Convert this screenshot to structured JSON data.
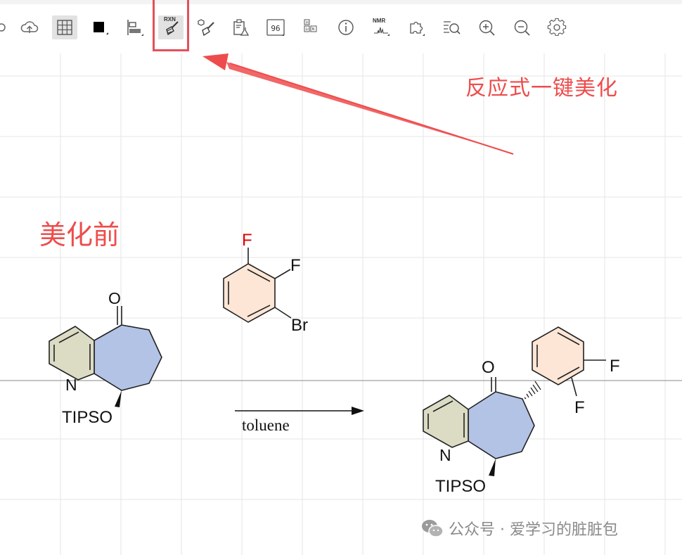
{
  "toolbar": {
    "items": [
      {
        "name": "upload-icon"
      },
      {
        "name": "grid-icon"
      },
      {
        "name": "color-fill-icon"
      },
      {
        "name": "align-icon"
      },
      {
        "name": "reaction-cleanup-icon",
        "label": "RXN"
      },
      {
        "name": "structure-cleanup-icon"
      },
      {
        "name": "clipboard-flask-icon"
      },
      {
        "name": "plate-96-icon",
        "label": "96"
      },
      {
        "name": "periodic-table-icon"
      },
      {
        "name": "info-icon"
      },
      {
        "name": "nmr-icon",
        "label": "NMR"
      },
      {
        "name": "puzzle-icon"
      },
      {
        "name": "search-structure-icon"
      },
      {
        "name": "zoom-in-icon"
      },
      {
        "name": "zoom-out-icon"
      },
      {
        "name": "settings-gear-icon"
      }
    ]
  },
  "annotations": {
    "one_click_beautify": "反应式一键美化",
    "before": "美化前"
  },
  "reaction": {
    "reactant1": {
      "atoms": [
        "O",
        "N",
        "TIPSO"
      ]
    },
    "reactant2": {
      "atoms": [
        "F",
        "F",
        "Br"
      ]
    },
    "arrow_condition": "toluene",
    "product": {
      "atoms": [
        "O",
        "N",
        "TIPSO",
        "F",
        "F"
      ]
    }
  },
  "watermark": {
    "text": "公众号 · 爱学习的脏脏包"
  },
  "colors": {
    "accent_red": "#e3505a",
    "annotation_red": "#ee4c4c",
    "pyridine_fill": "#dcdbc4",
    "cycloheptanone_fill": "#b3c3e6",
    "benzene_fill": "#fde6d6",
    "fluorine_red": "#e00000",
    "grid": "#e6e6e6"
  }
}
